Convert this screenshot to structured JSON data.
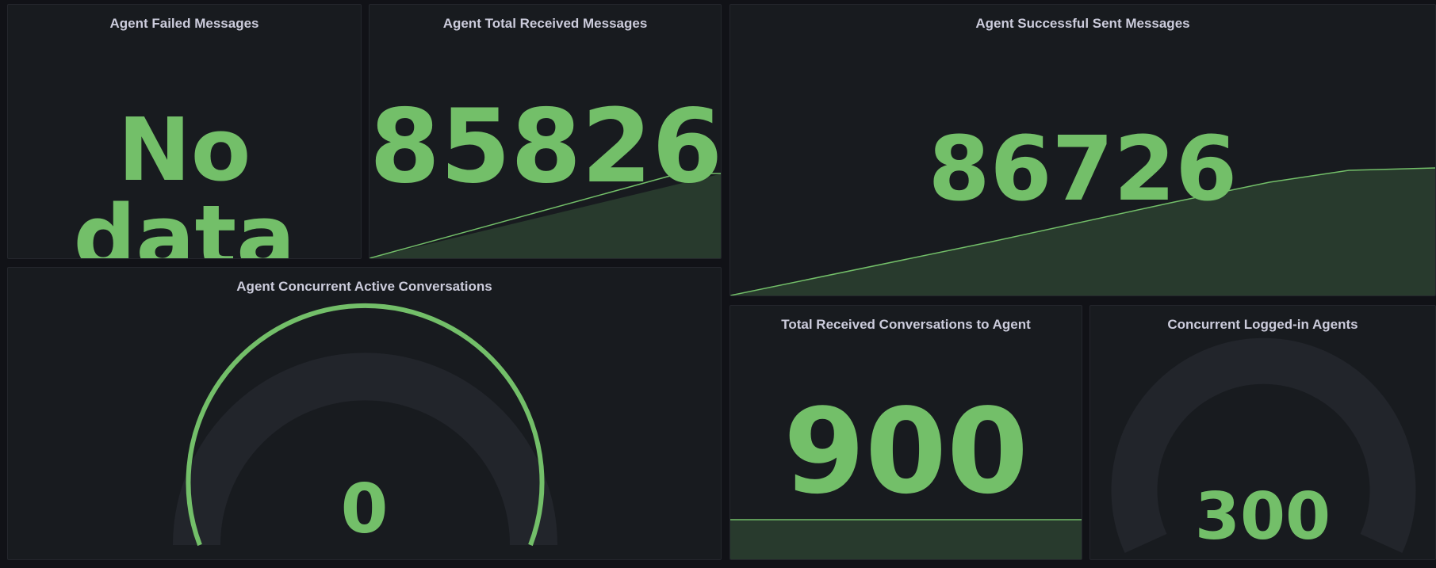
{
  "colors": {
    "background": "#111217",
    "panel": "#181b1f",
    "value": "#73bf69",
    "spark_fill": "#283a2d",
    "gauge_track": "#22252b"
  },
  "panels": {
    "failed": {
      "title": "Agent Failed Messages",
      "value": "No data"
    },
    "received": {
      "title": "Agent Total Received Messages",
      "value": "85826"
    },
    "sent": {
      "title": "Agent Successful Sent Messages",
      "value": "86726"
    },
    "concurrent": {
      "title": "Agent Concurrent Active Conversations",
      "value": "0",
      "gauge_fraction": 1.0
    },
    "conversations": {
      "title": "Total Received Conversations to Agent",
      "value": "900"
    },
    "logged_in": {
      "title": "Concurrent Logged-in Agents",
      "value": "300",
      "gauge_fraction": 0.0
    }
  }
}
